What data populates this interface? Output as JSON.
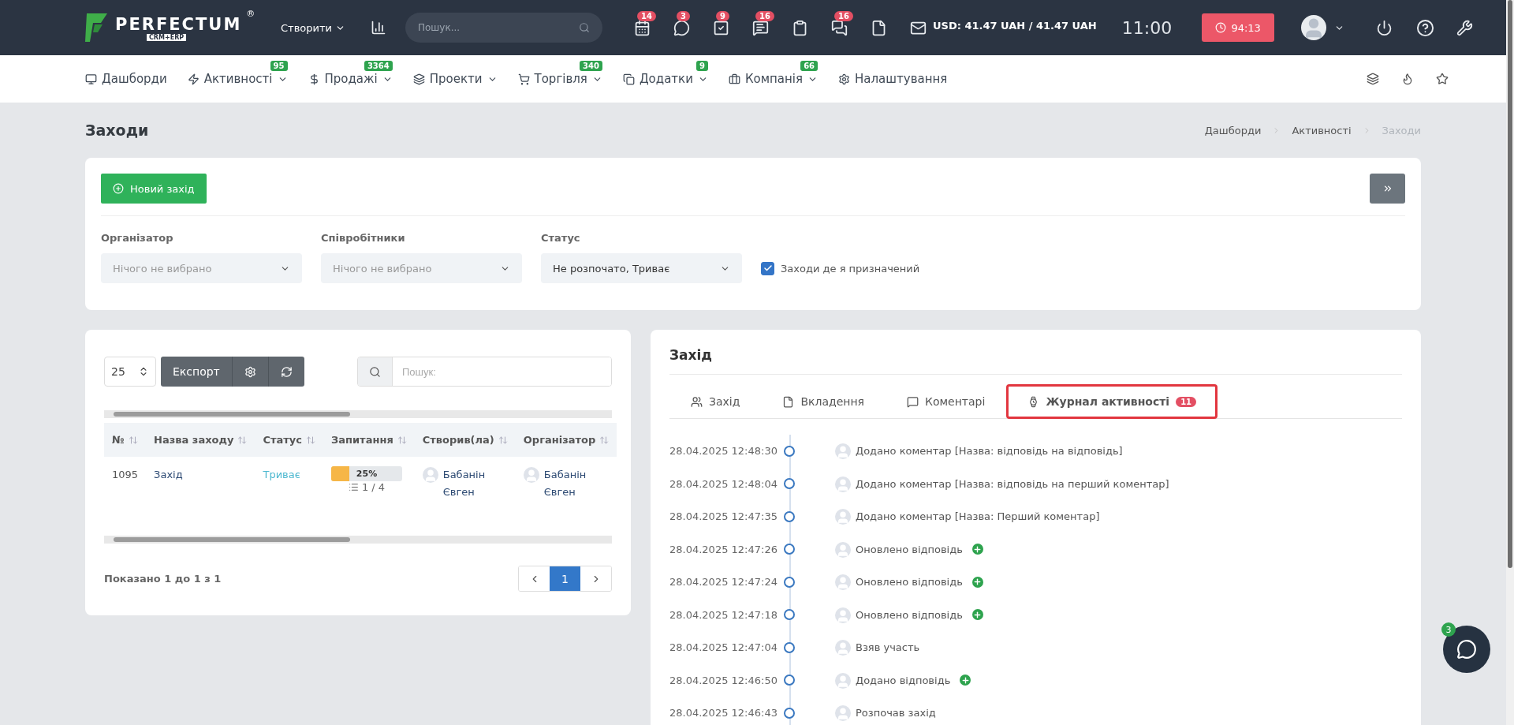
{
  "top_bar": {
    "logo": {
      "name": "PERFECTUM",
      "mark": "®",
      "sub": "CRM+ERP"
    },
    "create_menu": "Створити",
    "search": {
      "placeholder": "Пошук..."
    },
    "badges": [
      "14",
      "3",
      "9",
      "16",
      "16"
    ],
    "currency": "USD: 41.47 UAH / 41.47 UAH",
    "time": "11:00",
    "timer": "94:13"
  },
  "nav": {
    "items": [
      {
        "label": "Дашборди",
        "dropdown": false
      },
      {
        "label": "Активності",
        "dropdown": true,
        "badge": "95"
      },
      {
        "label": "Продажі",
        "dropdown": true,
        "badge": "3364"
      },
      {
        "label": "Проекти",
        "dropdown": true
      },
      {
        "label": "Торгівля",
        "dropdown": true,
        "badge": "340"
      },
      {
        "label": "Додатки",
        "dropdown": true,
        "badge": "9"
      },
      {
        "label": "Компанія",
        "dropdown": true,
        "badge": "66"
      },
      {
        "label": "Налаштування",
        "dropdown": false
      }
    ]
  },
  "page": {
    "title": "Заходи",
    "breadcrumbs": [
      {
        "label": "Дашборди",
        "current": false
      },
      {
        "label": "Активності",
        "current": false
      },
      {
        "label": "Заходи",
        "current": true
      }
    ]
  },
  "filters": {
    "new_button": "Новий захід",
    "fields": [
      {
        "label": "Організатор",
        "placeholder": "Нічого не вибрано"
      },
      {
        "label": "Співробітники",
        "placeholder": "Нічого не вибрано"
      },
      {
        "label": "Статус",
        "value": "Не розпочато, Триває"
      }
    ],
    "checkbox": {
      "label": "Заходи де я призначений",
      "checked": true
    }
  },
  "table_panel": {
    "page_size": "25",
    "export": "Експорт",
    "search": {
      "placeholder": "Пошук:"
    },
    "columns": [
      "№",
      "Назва заходу",
      "Статус",
      "Запитання",
      "Створив(ла)",
      "Організатор"
    ],
    "rows": [
      {
        "number": "1095",
        "name": "Захід",
        "status": "Триває",
        "questions": {
          "level": 0.25,
          "reading": "25%",
          "count": "1 / 4"
        },
        "creator": "Бабанін Євген",
        "organizer": "Бабанін Євген"
      }
    ],
    "info": "Показано 1 до 1 з 1",
    "pages": [
      {
        "label": "1",
        "selected": true
      }
    ]
  },
  "detail": {
    "title": "Захід",
    "tabs": [
      {
        "label": "Захід",
        "selected": false
      },
      {
        "label": "Вкладення",
        "selected": false
      },
      {
        "label": "Коментарі",
        "selected": false
      },
      {
        "label": "Журнал активності",
        "selected": true,
        "badge": "11"
      }
    ],
    "log": [
      {
        "time": "28.04.2025 12:48:30",
        "text": "Додано коментар [Назва: відповідь на відповідь]",
        "added": false
      },
      {
        "time": "28.04.2025 12:48:04",
        "text": "Додано коментар [Назва: відповідь на перший коментар]",
        "added": false
      },
      {
        "time": "28.04.2025 12:47:35",
        "text": "Додано коментар [Назва: Перший коментар]",
        "added": false
      },
      {
        "time": "28.04.2025 12:47:26",
        "text": "Оновлено відповідь",
        "added": true
      },
      {
        "time": "28.04.2025 12:47:24",
        "text": "Оновлено відповідь",
        "added": true
      },
      {
        "time": "28.04.2025 12:47:18",
        "text": "Оновлено відповідь",
        "added": true
      },
      {
        "time": "28.04.2025 12:47:04",
        "text": "Взяв участь",
        "added": false
      },
      {
        "time": "28.04.2025 12:46:50",
        "text": "Додано відповідь",
        "added": true
      },
      {
        "time": "28.04.2025 12:46:43",
        "text": "Розпочав захід",
        "added": false
      }
    ]
  },
  "chat": {
    "badge": "3"
  }
}
